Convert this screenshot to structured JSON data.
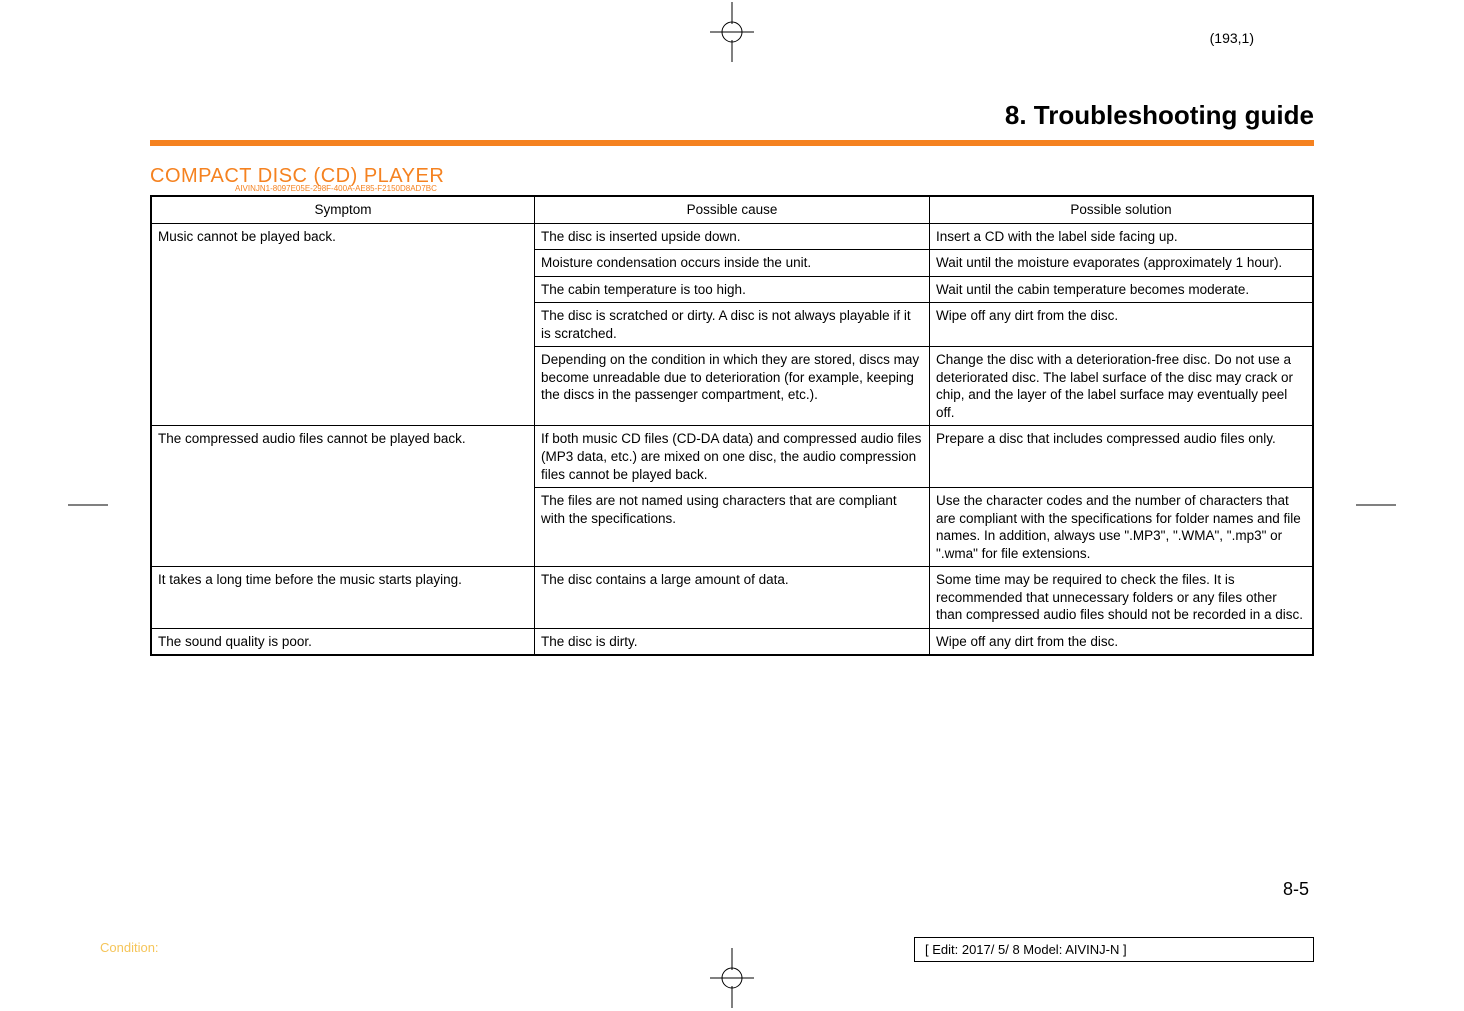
{
  "page_coord": "(193,1)",
  "section_title": "8. Troubleshooting guide",
  "player_heading": "COMPACT DISC (CD) PLAYER",
  "player_trace": "AIVINJN1-8097E05E-298F-400A-AE85-F2150D8AD7BC",
  "table": {
    "headers": [
      "Symptom",
      "Possible cause",
      "Possible solution"
    ],
    "rows": [
      {
        "symptom": "Music cannot be played back.",
        "symptom_rowspan": 5,
        "cause": "The disc is inserted upside down.",
        "solution": "Insert a CD with the label side facing up."
      },
      {
        "cause": "Moisture condensation occurs inside the unit.",
        "solution": "Wait until the moisture evaporates (approximately 1 hour)."
      },
      {
        "cause": "The cabin temperature is too high.",
        "solution": "Wait until the cabin temperature becomes moderate."
      },
      {
        "cause": "The disc is scratched or dirty. A disc is not always playable if it is scratched.",
        "solution": "Wipe off any dirt from the disc."
      },
      {
        "cause": "Depending on the condition in which they are stored, discs may become unreadable due to deterioration (for example, keeping the discs in the passenger compartment, etc.).",
        "solution": "Change the disc with a deterioration-free disc. Do not use a deteriorated disc. The label surface of the disc may crack or chip, and the layer of the label surface may eventually peel off."
      },
      {
        "symptom": "The compressed audio files cannot be played back.",
        "symptom_rowspan": 2,
        "cause": "If both music CD files (CD-DA data) and compressed audio files (MP3 data, etc.) are mixed on one disc, the audio compression files cannot be played back.",
        "solution": "Prepare a disc that includes compressed audio files only."
      },
      {
        "cause": "The files are not named using characters that are compliant with the specifications.",
        "solution": "Use the character codes and the number of characters that are compliant with the specifications for folder names and file names. In addition, always use \".MP3\", \".WMA\", \".mp3\" or \".wma\" for file extensions."
      },
      {
        "symptom": "It takes a long time before the music starts playing.",
        "symptom_rowspan": 1,
        "cause": "The disc contains a large amount of data.",
        "solution": "Some time may be required to check the files. It is recommended that unnecessary folders or any files other than compressed audio files should not be recorded in a disc."
      },
      {
        "symptom": "The sound quality is poor.",
        "symptom_rowspan": 1,
        "cause": "The disc is dirty.",
        "solution": "Wipe off any dirt from the disc."
      }
    ]
  },
  "page_num": "8-5",
  "condition_label": "Condition:",
  "edit_box": "[ Edit: 2017/ 5/ 8   Model:  AIVINJ-N ]"
}
